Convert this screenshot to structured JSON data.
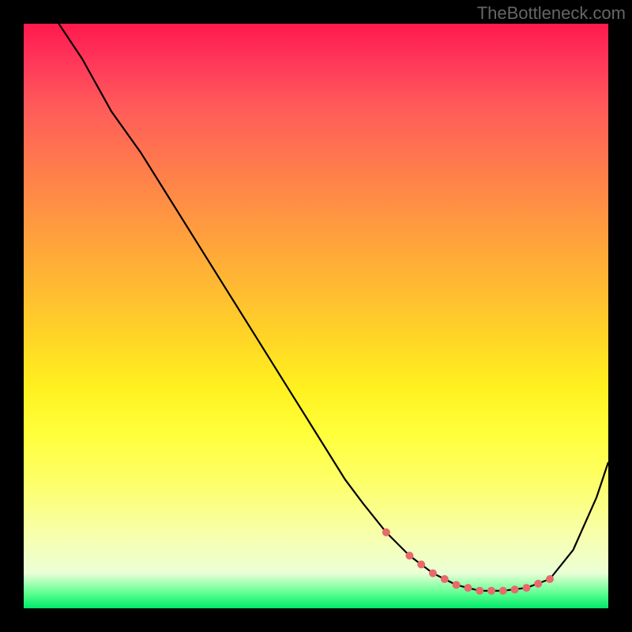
{
  "watermark": "TheBottleneck.com",
  "chart_data": {
    "type": "line",
    "title": "",
    "xlabel": "",
    "ylabel": "",
    "xlim": [
      0,
      100
    ],
    "ylim": [
      0,
      100
    ],
    "series": [
      {
        "name": "bottleneck-curve",
        "x": [
          6,
          10,
          15,
          20,
          25,
          30,
          35,
          40,
          45,
          50,
          55,
          58,
          62,
          66,
          70,
          74,
          78,
          82,
          86,
          90,
          94,
          98,
          100
        ],
        "y": [
          100,
          94,
          85,
          78,
          70,
          62,
          54,
          46,
          38,
          30,
          22,
          18,
          13,
          9,
          6,
          4,
          3,
          3,
          3.5,
          5,
          10,
          19,
          25
        ]
      }
    ],
    "highlight_points": {
      "name": "optimal-zone-dots",
      "x": [
        62,
        66,
        68,
        70,
        72,
        74,
        76,
        78,
        80,
        82,
        84,
        86,
        88,
        90
      ],
      "y": [
        13,
        9,
        7.5,
        6,
        5,
        4,
        3.5,
        3,
        3,
        3,
        3.2,
        3.5,
        4.2,
        5
      ]
    },
    "gradient_bands": [
      {
        "color": "#ff1a4d",
        "stop": 0
      },
      {
        "color": "#ffb733",
        "stop": 44
      },
      {
        "color": "#ffff3a",
        "stop": 70
      },
      {
        "color": "#00e86a",
        "stop": 100
      }
    ]
  }
}
